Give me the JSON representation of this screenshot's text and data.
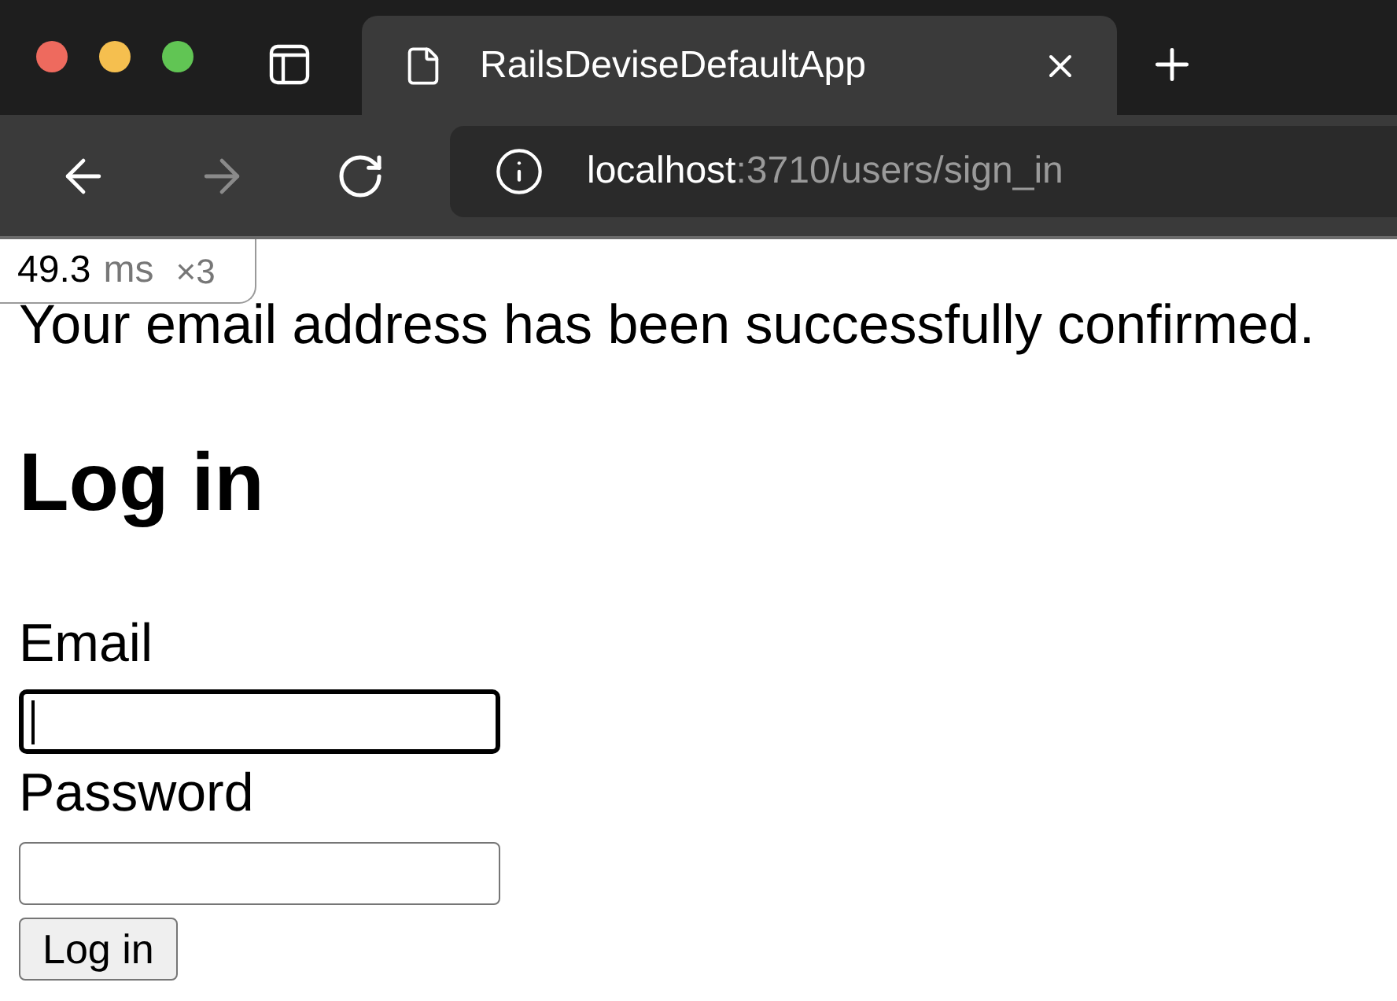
{
  "browser": {
    "tabs": [
      {
        "title": "RailsDeviseDefaultApp",
        "selected": true
      }
    ],
    "back": {
      "disabled": false
    },
    "forward": {
      "disabled": true
    },
    "address": {
      "host": "localhost",
      "path": ":3710/users/sign_in"
    }
  },
  "profiler_badge": {
    "time": "49.3",
    "unit": "ms",
    "count": "×3"
  },
  "page": {
    "notice": "Your email address has been successfully confirmed.",
    "heading": "Log in",
    "fields": [
      {
        "label": "Email",
        "focused": true
      },
      {
        "label": "Password",
        "focused": false
      }
    ],
    "submit": "Log in"
  }
}
